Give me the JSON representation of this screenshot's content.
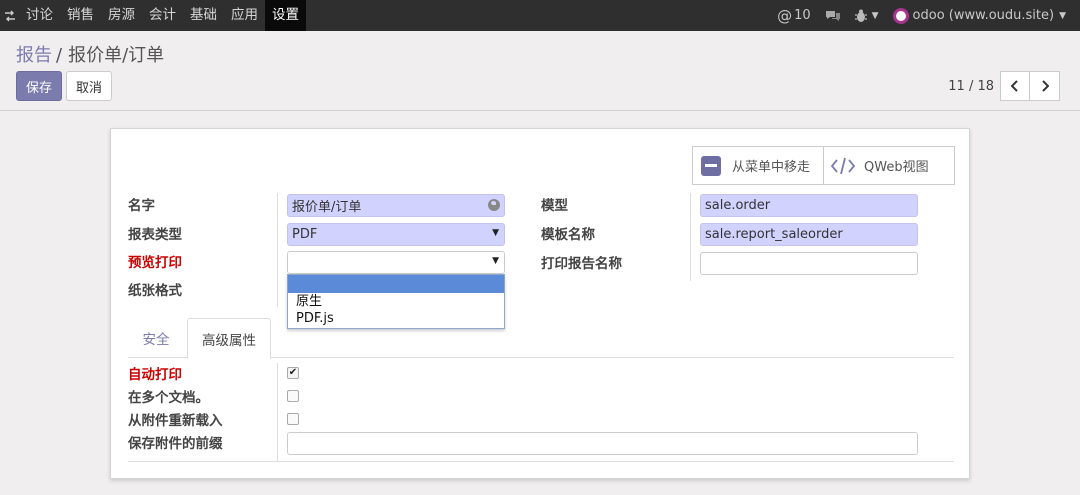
{
  "navbar": {
    "menu": [
      "讨论",
      "销售",
      "房源",
      "会计",
      "基础",
      "应用",
      "设置"
    ],
    "active_menu": "设置",
    "messages_count": "10",
    "user": "odoo (www.oudu.site)"
  },
  "breadcrumb": {
    "parent": "报告",
    "current": "报价单/订单"
  },
  "buttons": {
    "save": "保存",
    "cancel": "取消"
  },
  "pager": {
    "value": "11 / 18"
  },
  "button_box": {
    "remove_menu": "从菜单中移走",
    "qweb_view": "QWeb视图"
  },
  "form": {
    "name_label": "名字",
    "name_value": "报价单/订单",
    "report_type_label": "报表类型",
    "report_type_value": "PDF",
    "preview_label": "预览打印",
    "preview_value": "",
    "paper_format_label": "纸张格式",
    "model_label": "模型",
    "model_value": "sale.order",
    "template_label": "模板名称",
    "template_value": "sale.report_saleorder",
    "print_name_label": "打印报告名称",
    "print_name_value": ""
  },
  "dropdown": {
    "options": [
      "",
      "原生",
      "PDF.js"
    ]
  },
  "tabs": [
    "安全",
    "高级属性"
  ],
  "advanced": {
    "auto_print_label": "自动打印",
    "auto_print_checked": true,
    "multi_docs_label": "在多个文档。",
    "multi_docs_checked": false,
    "reload_label": "从附件重新载入",
    "reload_checked": false,
    "prefix_label": "保存附件的前缀",
    "prefix_value": ""
  },
  "colors": {
    "navbar_bg": "#2f2f30",
    "primary": "#7c7bad",
    "required_field": "#d2d2ff",
    "required_label": "#cc0000"
  }
}
